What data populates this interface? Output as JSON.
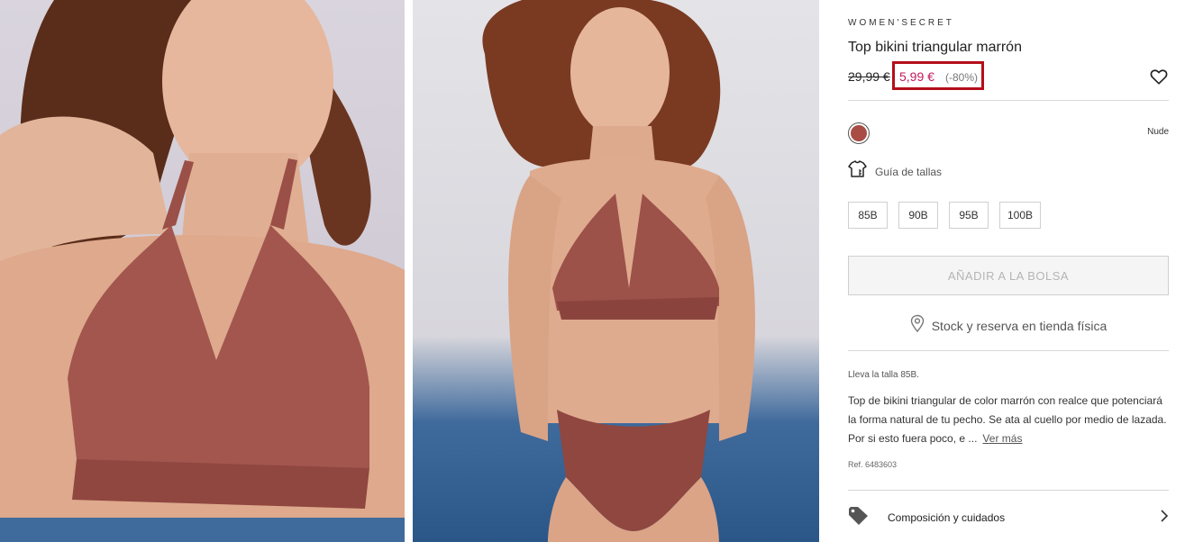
{
  "gallery": {
    "images": [
      {
        "name": "product-photo-closeup"
      },
      {
        "name": "product-photo-fullbody"
      }
    ]
  },
  "product": {
    "brand": "WOMEN'SECRET",
    "title": "Top bikini triangular marrón",
    "old_price": "29,99 €",
    "new_price": "5,99 €",
    "discount": "(-80%)",
    "color": {
      "name": "Nude",
      "hex": "#a84c45"
    },
    "size_guide_label": "Guía de tallas",
    "sizes": [
      "85B",
      "90B",
      "95B",
      "100B"
    ],
    "add_to_bag_label": "AÑADIR A LA BOLSA",
    "store_label": "Stock y reserva en tienda física",
    "size_worn": "Lleva la talla 85B.",
    "description": "Top de bikini triangular de color marrón con realce que potenciará la forma natural de tu pecho. Se ata al cuello por medio de lazada. Por si esto fuera poco, e ...",
    "more_label": "Ver más",
    "reference": "Ref. 6483603",
    "composition_label": "Composición y cuidados"
  },
  "icons": {
    "favorite": "heart-icon",
    "size_guide": "shirt-ruler-icon",
    "store": "location-pin-icon",
    "composition": "tag-icon",
    "chevron": "chevron-right-icon"
  },
  "colors": {
    "sale": "#c2185b",
    "highlight": "#b30f1a",
    "swatch": "#a84c45"
  }
}
